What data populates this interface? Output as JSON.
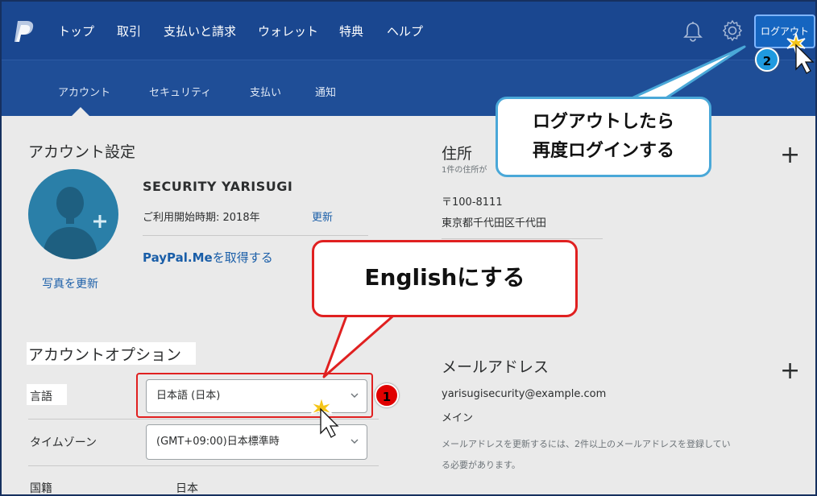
{
  "header": {
    "nav": [
      "トップ",
      "取引",
      "支払いと請求",
      "ウォレット",
      "特典",
      "ヘルプ"
    ],
    "logout_label": "ログアウト",
    "icons": [
      "paypal-logo-icon",
      "bell-icon",
      "gear-icon"
    ]
  },
  "subnav": {
    "items": [
      "アカウント",
      "セキュリティ",
      "支払い",
      "通知"
    ],
    "selected": "アカウント"
  },
  "account": {
    "section_title": "アカウント設定",
    "name": "SECURITY YARISUGI",
    "member_since": "ご利用開始時期: 2018年",
    "update_label": "更新",
    "paypalme_brand": "PayPal.Me",
    "paypalme_suffix": "を取得する",
    "update_photo": "写真を更新"
  },
  "address": {
    "title": "住所",
    "subtitle": "1件の住所が",
    "postal": "〒100-8111",
    "line": "東京都千代田区千代田"
  },
  "options": {
    "title": "アカウントオプション",
    "language_label": "言語",
    "language_value": "日本語 (日本)",
    "timezone_label": "タイムゾーン",
    "timezone_value": "(GMT+09:00)日本標準時",
    "country_label": "国籍",
    "country_value": "日本"
  },
  "email": {
    "title": "メールアドレス",
    "address": "yarisugisecurity@example.com",
    "tag": "メイン",
    "note_1": "メールアドレスを更新するには、2件以上のメールアドレスを登録してい",
    "note_2": "る必要があります。"
  },
  "annotations": {
    "callout_logout_1": "ログアウトしたら",
    "callout_logout_2": "再度ログインする",
    "callout_english": "Englishにする",
    "badge_1": "1",
    "badge_2": "2"
  },
  "colors": {
    "header_bg": "#1a4790",
    "subnav_bg": "#1f4e97",
    "link": "#1a5ea8",
    "logout_btn": "#1565c0",
    "callout_red": "#e02020",
    "callout_blue": "#4aa8d8"
  }
}
